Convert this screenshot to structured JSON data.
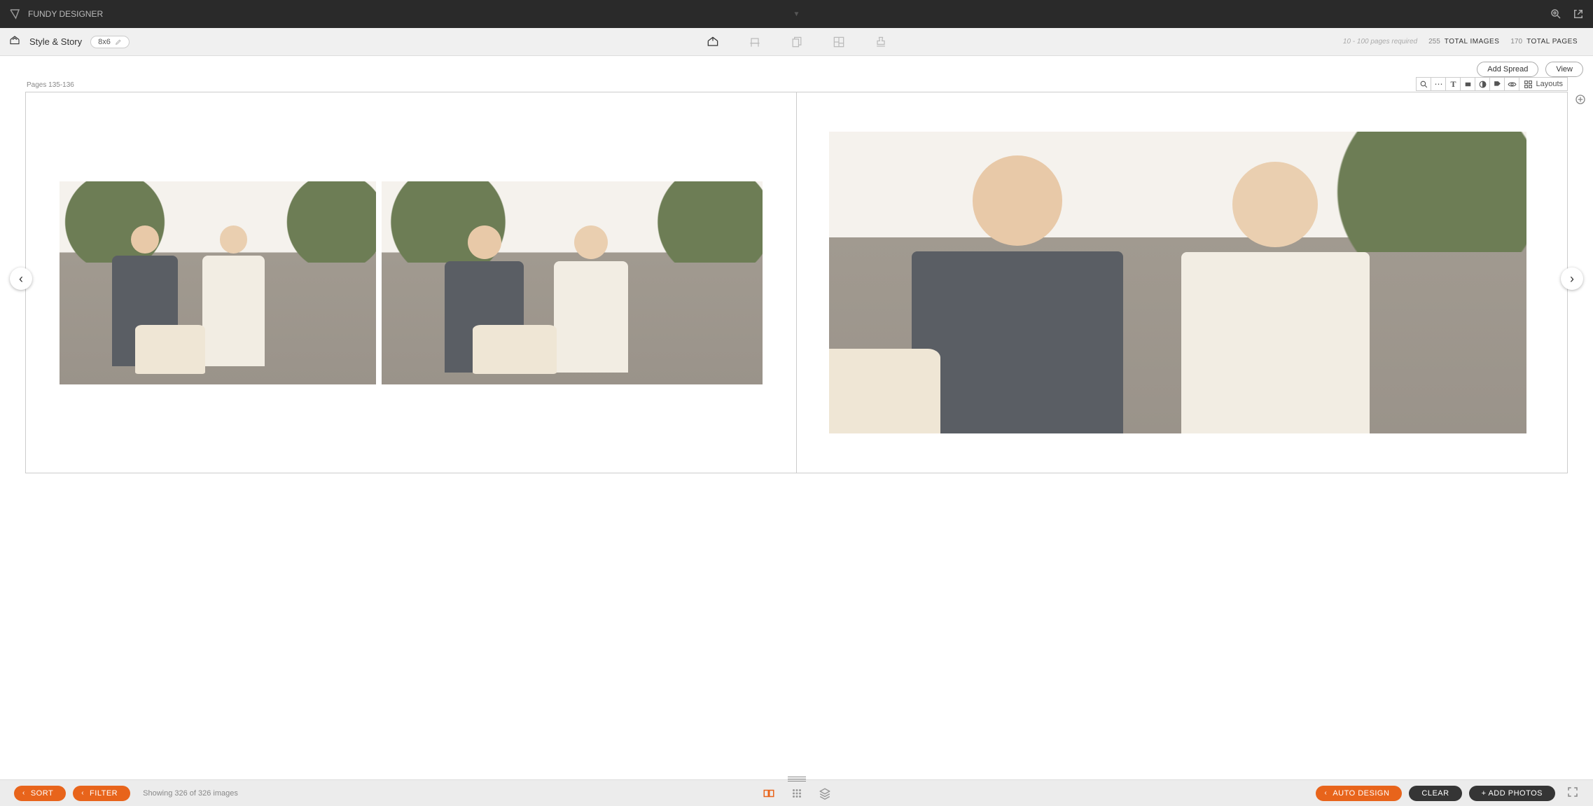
{
  "app": {
    "name": "FUNDY DESIGNER"
  },
  "subbar": {
    "mode": "Style & Story",
    "size": "8x6",
    "pages_required": "10 - 100 pages required",
    "total_images_count": "255",
    "total_images_label": "TOTAL IMAGES",
    "total_pages_count": "170",
    "total_pages_label": "TOTAL PAGES"
  },
  "actions": {
    "add_spread": "Add Spread",
    "view": "View"
  },
  "canvas": {
    "pages_label": "Pages 135-136"
  },
  "toolstrip": {
    "layouts": "Layouts"
  },
  "bottom": {
    "sort": "SORT",
    "filter": "FILTER",
    "status": "Showing 326 of 326 images",
    "auto_design": "AUTO DESIGN",
    "clear": "CLEAR",
    "add_photos": "+ ADD PHOTOS"
  }
}
